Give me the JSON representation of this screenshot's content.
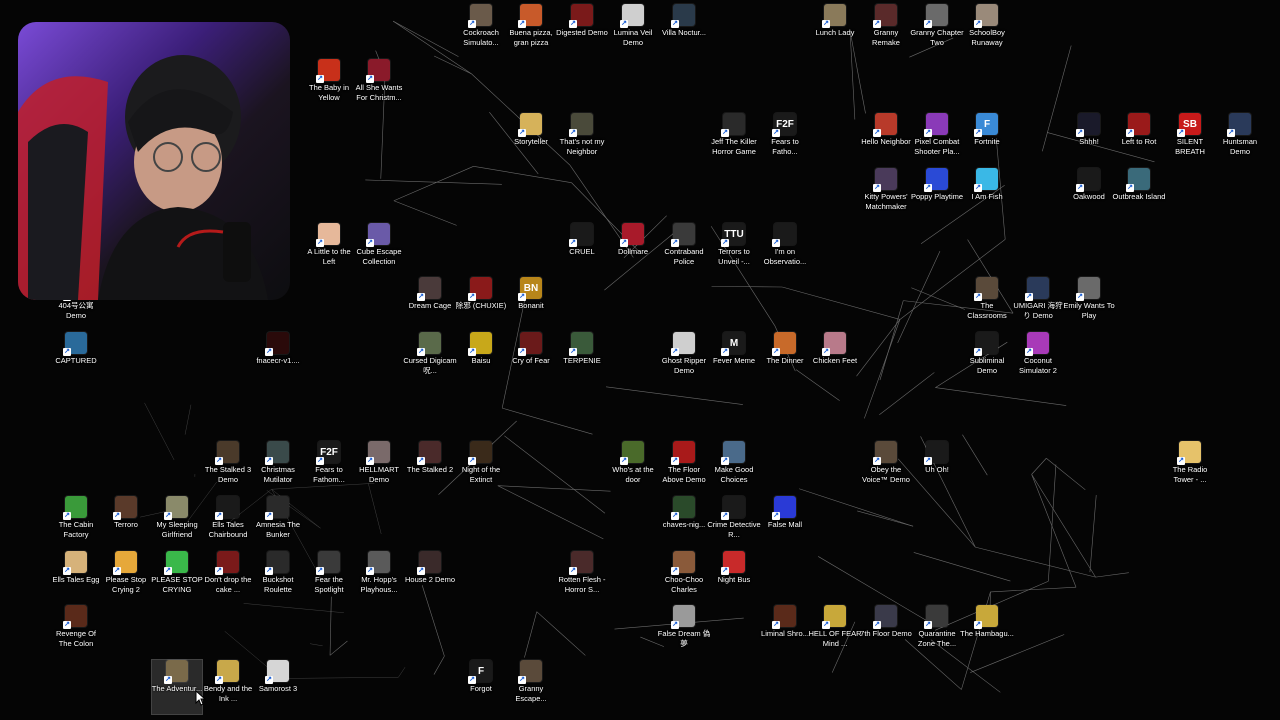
{
  "desktop": {
    "icons": [
      {
        "label": "Cockroach Simulato...",
        "color": "#6a5a4a",
        "glyph": ""
      },
      {
        "label": "Buena pizza, gran pizza",
        "color": "#c85a2a",
        "glyph": ""
      },
      {
        "label": "Digested Demo",
        "color": "#7a1a1a",
        "glyph": ""
      },
      {
        "label": "Lumina Veil Demo",
        "color": "#cfcfcf",
        "glyph": ""
      },
      {
        "label": "Villa Noctur...",
        "color": "#2a3a4a",
        "glyph": ""
      },
      {
        "label": "Lunch Lady",
        "color": "#8a7a5a",
        "glyph": ""
      },
      {
        "label": "Granny Remake",
        "color": "#5a2a2a",
        "glyph": ""
      },
      {
        "label": "Granny Chapter Two",
        "color": "#6a6a6a",
        "glyph": ""
      },
      {
        "label": "SchoolBoy Runaway",
        "color": "#9a8a7a",
        "glyph": ""
      },
      {
        "label": "The Baby in Yellow",
        "color": "#c8301a",
        "glyph": ""
      },
      {
        "label": "All She Wants For Christm...",
        "color": "#8a1a2a",
        "glyph": ""
      },
      {
        "label": "Storyteller",
        "color": "#d6b25a",
        "glyph": ""
      },
      {
        "label": "That's not my Neighbor",
        "color": "#4a4a3a",
        "glyph": ""
      },
      {
        "label": "Jeff The Killer Horror Game",
        "color": "#2a2a2a",
        "glyph": ""
      },
      {
        "label": "Fears to Fatho...",
        "color": "#1a1a1a",
        "glyph": "F2F"
      },
      {
        "label": "Hello Neighbor",
        "color": "#b83a2a",
        "glyph": ""
      },
      {
        "label": "Pixel Combat Shooter Pla...",
        "color": "#8a3ab8",
        "glyph": ""
      },
      {
        "label": "Fortnite",
        "color": "#3a8ad6",
        "glyph": "F"
      },
      {
        "label": "Shhh!",
        "color": "#1a1a2a",
        "glyph": ""
      },
      {
        "label": "Left to Rot",
        "color": "#9a1a1a",
        "glyph": ""
      },
      {
        "label": "SILENT BREATH",
        "color": "#c81a1a",
        "glyph": "SB"
      },
      {
        "label": "Huntsman Demo",
        "color": "#2a3a5a",
        "glyph": ""
      },
      {
        "label": "Kitty Powers' Matchmaker",
        "color": "#4a3a5a",
        "glyph": ""
      },
      {
        "label": "Poppy Playtime",
        "color": "#2a4ad6",
        "glyph": ""
      },
      {
        "label": "I Am Fish",
        "color": "#3ab8e6",
        "glyph": ""
      },
      {
        "label": "Oakwood",
        "color": "#1a1a1a",
        "glyph": ""
      },
      {
        "label": "Outbreak Island",
        "color": "#3a6a7a",
        "glyph": ""
      },
      {
        "label": "A Little to the Left",
        "color": "#e6b89a",
        "glyph": ""
      },
      {
        "label": "Cube Escape Collection",
        "color": "#6a5aa8",
        "glyph": ""
      },
      {
        "label": "CRUEL",
        "color": "#1a1a1a",
        "glyph": ""
      },
      {
        "label": "Dollmare",
        "color": "#a81a2a",
        "glyph": ""
      },
      {
        "label": "Contraband Police",
        "color": "#3a3a3a",
        "glyph": ""
      },
      {
        "label": "Terrors to Unveil -...",
        "color": "#1a1a1a",
        "glyph": "TTU"
      },
      {
        "label": "I'm on Observatio...",
        "color": "#1a1a1a",
        "glyph": ""
      },
      {
        "label": "The Classrooms",
        "color": "#5a4a3a",
        "glyph": ""
      },
      {
        "label": "UMIGARI 海狩り Demo",
        "color": "#2a3a5a",
        "glyph": ""
      },
      {
        "label": "Emily Wants To Play",
        "color": "#6a6a6a",
        "glyph": ""
      },
      {
        "label": "404号公寓 Demo",
        "color": "#3a3a3a",
        "glyph": ""
      },
      {
        "label": "Dream Cage",
        "color": "#4a3a3a",
        "glyph": ""
      },
      {
        "label": "除邪 (CHUXIE)",
        "color": "#8a1a1a",
        "glyph": ""
      },
      {
        "label": "Bonanit",
        "color": "#b8861a",
        "glyph": "BN"
      },
      {
        "label": "CAPTURED",
        "color": "#2a6a9a",
        "glyph": ""
      },
      {
        "label": "fnacecr-v1....",
        "color": "#2a0a0a",
        "glyph": ""
      },
      {
        "label": "Cursed Digicam 呪...",
        "color": "#5a6a4a",
        "glyph": ""
      },
      {
        "label": "Baisu",
        "color": "#c8a81a",
        "glyph": ""
      },
      {
        "label": "Cry of Fear",
        "color": "#6a1a1a",
        "glyph": ""
      },
      {
        "label": "TERPENIE",
        "color": "#3a5a3a",
        "glyph": ""
      },
      {
        "label": "Ghost Ripper Demo",
        "color": "#cfcfcf",
        "glyph": ""
      },
      {
        "label": "Fever Meme",
        "color": "#1a1a1a",
        "glyph": "M"
      },
      {
        "label": "The Dinner",
        "color": "#c86a2a",
        "glyph": ""
      },
      {
        "label": "Chicken Feet",
        "color": "#b87a8a",
        "glyph": ""
      },
      {
        "label": "Subliminal Demo",
        "color": "#1a1a1a",
        "glyph": ""
      },
      {
        "label": "Coconut Simulator 2",
        "color": "#a83ab8",
        "glyph": ""
      },
      {
        "label": "The Stalked 3 Demo",
        "color": "#4a3a2a",
        "glyph": ""
      },
      {
        "label": "Christmas Mutilator",
        "color": "#3a4a4a",
        "glyph": ""
      },
      {
        "label": "Fears to Fathom...",
        "color": "#1a1a1a",
        "glyph": "F2F"
      },
      {
        "label": "HELLMART Demo",
        "color": "#7a6a6a",
        "glyph": ""
      },
      {
        "label": "The Stalked 2",
        "color": "#4a2a2a",
        "glyph": ""
      },
      {
        "label": "Night of the Extinct",
        "color": "#3a2a1a",
        "glyph": ""
      },
      {
        "label": "Who's at the door",
        "color": "#4a6a2a",
        "glyph": ""
      },
      {
        "label": "The Floor Above Demo",
        "color": "#a81a1a",
        "glyph": ""
      },
      {
        "label": "Make Good Choices",
        "color": "#4a6a8a",
        "glyph": ""
      },
      {
        "label": "Obey the Voice™ Demo",
        "color": "#5a4a3a",
        "glyph": ""
      },
      {
        "label": "Uh Oh!",
        "color": "#1a1a1a",
        "glyph": ""
      },
      {
        "label": "The Radio Tower - ...",
        "color": "#e6c26a",
        "glyph": ""
      },
      {
        "label": "The Cabin Factory",
        "color": "#3a9a3a",
        "glyph": ""
      },
      {
        "label": "Terroro",
        "color": "#5a3a2a",
        "glyph": ""
      },
      {
        "label": "My Sleeping Girlfriend",
        "color": "#8a8a6a",
        "glyph": ""
      },
      {
        "label": "Ells Tales Chairbound",
        "color": "#1a1a1a",
        "glyph": ""
      },
      {
        "label": "Amnesia The Bunker",
        "color": "#2a2a2a",
        "glyph": ""
      },
      {
        "label": "chaves-nig...",
        "color": "#2a4a2a",
        "glyph": ""
      },
      {
        "label": "Crime Detective R...",
        "color": "#1a1a1a",
        "glyph": ""
      },
      {
        "label": "False Mall",
        "color": "#2a3ad6",
        "glyph": ""
      },
      {
        "label": "Ells Tales Egg",
        "color": "#d6b27a",
        "glyph": ""
      },
      {
        "label": "Please Stop Crying 2",
        "color": "#e6a83a",
        "glyph": ""
      },
      {
        "label": "PLEASE STOP CRYING",
        "color": "#3ab84a",
        "glyph": ""
      },
      {
        "label": "Don't drop the cake ...",
        "color": "#7a1a1a",
        "glyph": ""
      },
      {
        "label": "Buckshot Roulette",
        "color": "#2a2a2a",
        "glyph": ""
      },
      {
        "label": "Fear the Spotlight",
        "color": "#3a3a3a",
        "glyph": ""
      },
      {
        "label": "Mr. Hopp's Playhous...",
        "color": "#5a5a5a",
        "glyph": ""
      },
      {
        "label": "House 2 Demo",
        "color": "#3a2a2a",
        "glyph": ""
      },
      {
        "label": "Rotten Flesh - Horror S...",
        "color": "#4a2a2a",
        "glyph": ""
      },
      {
        "label": "Choo-Choo Charles",
        "color": "#8a5a3a",
        "glyph": ""
      },
      {
        "label": "Night Bus",
        "color": "#c82a2a",
        "glyph": ""
      },
      {
        "label": "Revenge Of The Colon",
        "color": "#5a2a1a",
        "glyph": ""
      },
      {
        "label": "False Dream 偽夢",
        "color": "#9a9a9a",
        "glyph": ""
      },
      {
        "label": "Liminal Shro...",
        "color": "#5a2a1a",
        "glyph": ""
      },
      {
        "label": "HELL OF FEAR Mind ...",
        "color": "#c8a83a",
        "glyph": ""
      },
      {
        "label": "7th Floor Demo",
        "color": "#3a3a4a",
        "glyph": ""
      },
      {
        "label": "Quarantine Zone The...",
        "color": "#3a3a3a",
        "glyph": ""
      },
      {
        "label": "The Hambagu...",
        "color": "#c8a83a",
        "glyph": ""
      },
      {
        "label": "The Adventur...",
        "color": "#7a6a4a",
        "glyph": ""
      },
      {
        "label": "Bendy and the Ink ...",
        "color": "#c8a84a",
        "glyph": ""
      },
      {
        "label": "Samorost 3",
        "color": "#d6d6d6",
        "glyph": ""
      },
      {
        "label": "Forgot",
        "color": "#1a1a1a",
        "glyph": "F"
      },
      {
        "label": "Granny Escape...",
        "color": "#5a4a3a",
        "glyph": ""
      }
    ]
  }
}
